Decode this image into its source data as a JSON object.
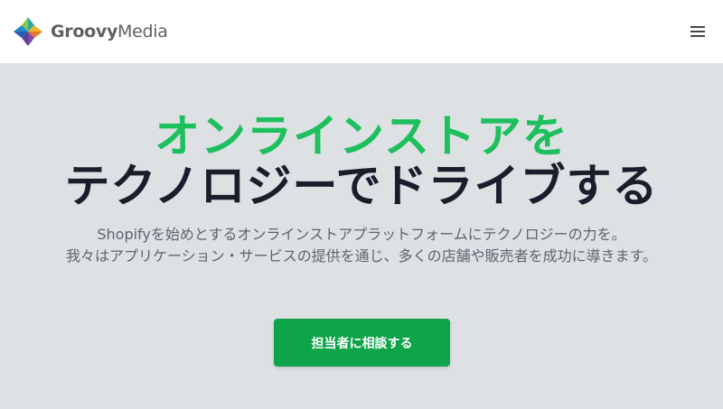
{
  "header": {
    "brand_part1": "Groovy",
    "brand_part2": "Media",
    "logo_icon": "groovymedia-logo-icon",
    "menu_icon": "hamburger-menu-icon"
  },
  "hero": {
    "headline_line1": "オンラインストアを",
    "headline_line2": "テクノロジーでドライブする",
    "subcopy_line1": "Shopifyを始めとするオンラインストアプラットフォームにテクノロジーの力を。",
    "subcopy_line2": "我々はアプリケーション・サービスの提供を通じ、多くの店舗や販売者を成功に導きます。",
    "cta_label": "担当者に相談する"
  },
  "colors": {
    "accent_green": "#1ebf5d",
    "cta_green": "#0ea44a",
    "headline_dark": "#1a1d2a",
    "hero_background": "#dde1e4"
  }
}
